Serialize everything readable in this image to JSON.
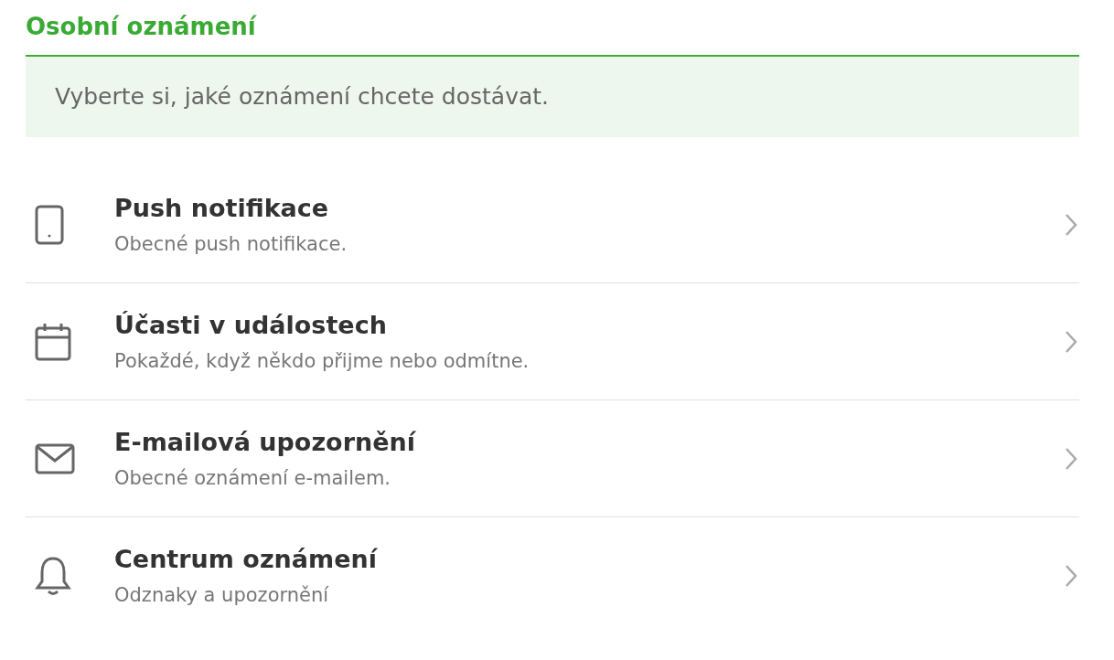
{
  "title": "Osobní oznámení",
  "notice": "Vyberte si, jaké oznámení chcete dostávat.",
  "items": [
    {
      "kind": "phone",
      "title": "Push notifikace",
      "subtitle": "Obecné push notifikace."
    },
    {
      "kind": "calendar",
      "title": "Účasti v událostech",
      "subtitle": "Pokaždé, když někdo přijme nebo odmítne."
    },
    {
      "kind": "mail",
      "title": "E-mailová upozornění",
      "subtitle": "Obecné oznámení e-mailem."
    },
    {
      "kind": "bell",
      "title": "Centrum oznámení",
      "subtitle": "Odznaky a upozornění"
    }
  ]
}
